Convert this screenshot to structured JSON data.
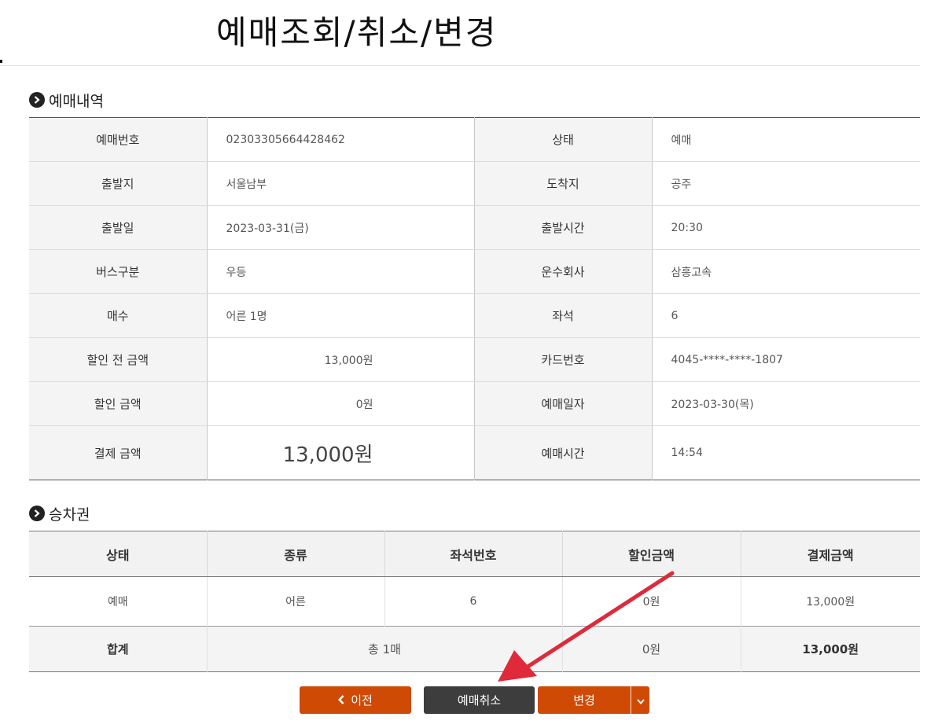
{
  "page_title": "예매조회/취소/변경",
  "sections": {
    "booking_details": "예매내역",
    "ticket": "승차권"
  },
  "booking": {
    "rows": [
      {
        "l1": "예매번호",
        "v1": "02303305664428462",
        "l2": "상태",
        "v2": "예매"
      },
      {
        "l1": "출발지",
        "v1": "서울남부",
        "l2": "도착지",
        "v2": "공주"
      },
      {
        "l1": "출발일",
        "v1": "2023-03-31(금)",
        "l2": "출발시간",
        "v2": "20:30"
      },
      {
        "l1": "버스구분",
        "v1": "우등",
        "l2": "운수회사",
        "v2": "삼흥고속"
      },
      {
        "l1": "매수",
        "v1": "어른 1명",
        "l2": "좌석",
        "v2": "6"
      },
      {
        "l1": "할인 전 금액",
        "v1": "13,000원",
        "l2": "카드번호",
        "v2": "4045-****-****-1807"
      },
      {
        "l1": "할인 금액",
        "v1": "0원",
        "l2": "예매일자",
        "v2": "2023-03-30(목)"
      },
      {
        "l1": "결제 금액",
        "v1": "13,000원",
        "l2": "예매시간",
        "v2": "14:54"
      }
    ]
  },
  "ticket": {
    "headers": [
      "상태",
      "종류",
      "좌석번호",
      "할인금액",
      "결제금액"
    ],
    "row": [
      "예매",
      "어른",
      "6",
      "0원",
      "13,000원"
    ],
    "total": {
      "label": "합계",
      "count": "총 1매",
      "discount": "0원",
      "payment": "13,000원"
    }
  },
  "buttons": {
    "prev": "이전",
    "cancel": "예매취소",
    "change": "변경"
  },
  "colors": {
    "accent_orange": "#cf4a04",
    "dark_button": "#3d3d3d",
    "annotation_arrow": "#e0293a"
  }
}
